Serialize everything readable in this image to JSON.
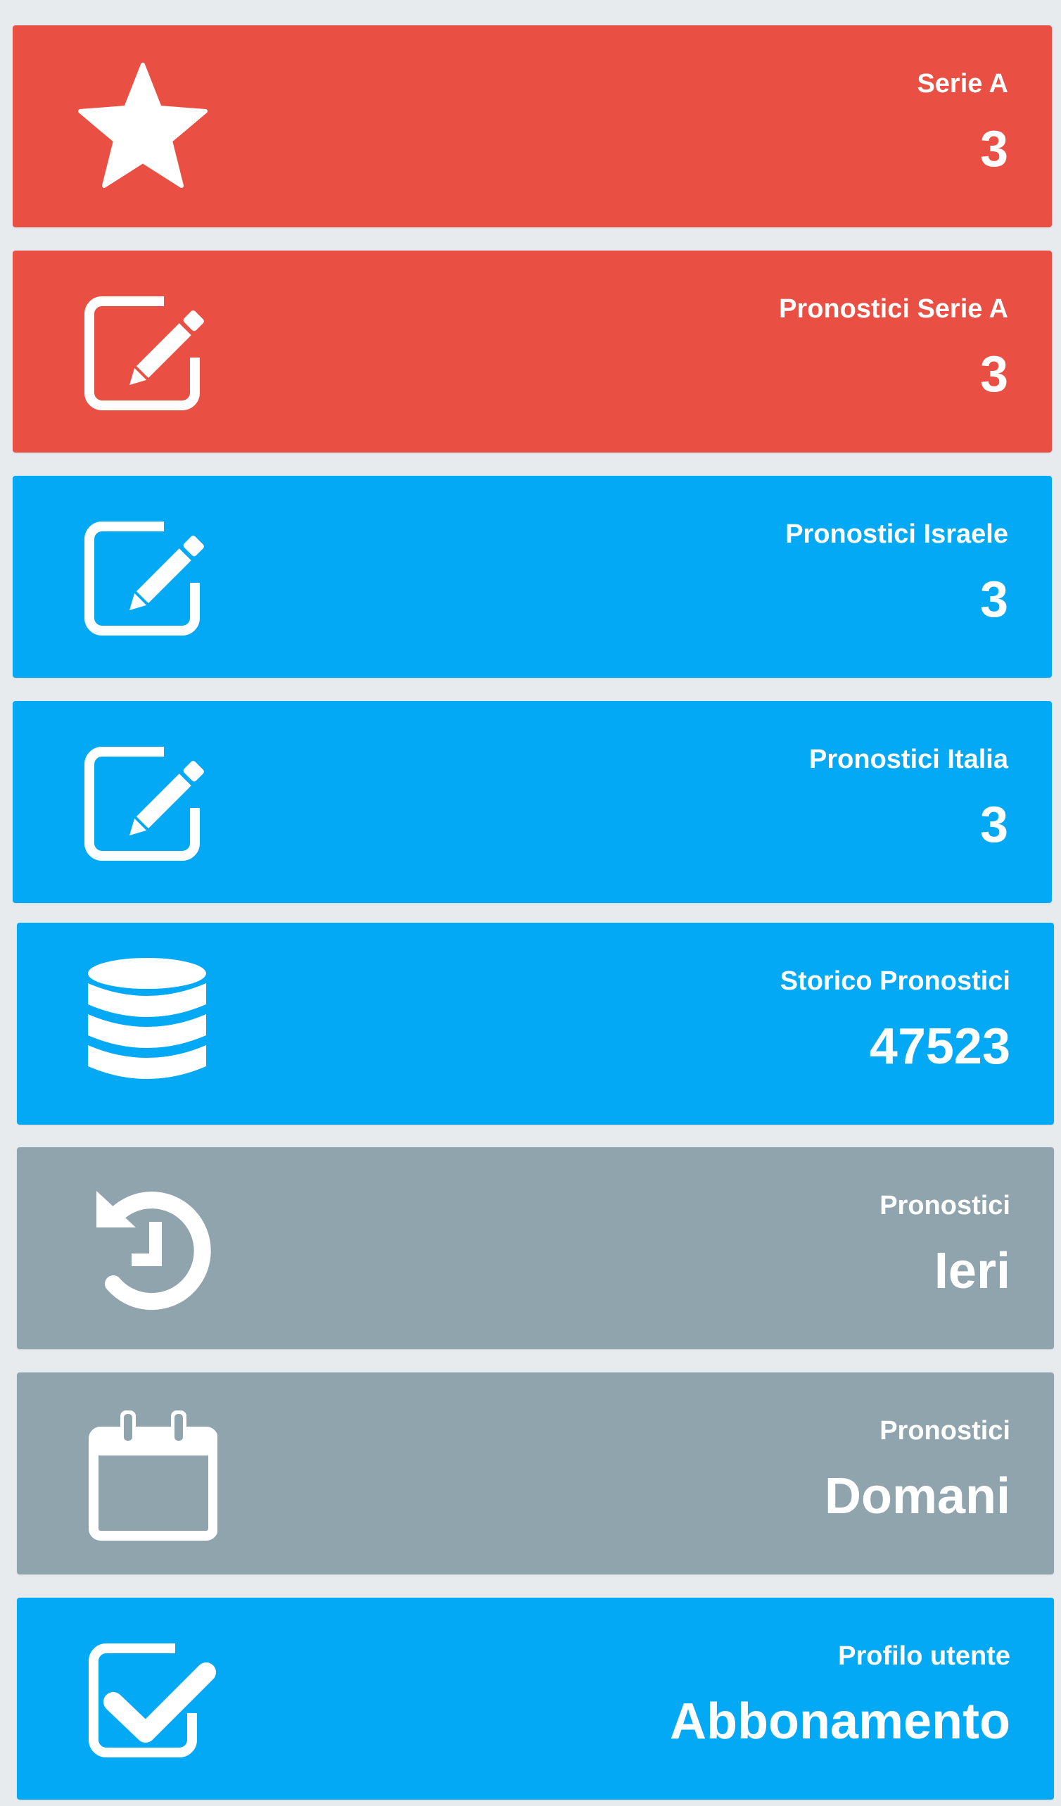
{
  "colors": {
    "background": "#e8ebee",
    "red": "#e94f43",
    "blue": "#03a9f4",
    "gray": "#90a4ae",
    "text": "#ffffff"
  },
  "tiles": [
    {
      "icon": "star-icon",
      "color": "red",
      "title": "Serie A",
      "value": "3"
    },
    {
      "icon": "edit-icon",
      "color": "red",
      "title": "Pronostici Serie A",
      "value": "3"
    },
    {
      "icon": "edit-icon",
      "color": "blue",
      "title": "Pronostici Israele",
      "value": "3"
    },
    {
      "icon": "edit-icon",
      "color": "blue",
      "title": "Pronostici Italia",
      "value": "3"
    },
    {
      "icon": "database-icon",
      "color": "blue",
      "title": "Storico Pronostici",
      "value": "47523"
    },
    {
      "icon": "history-icon",
      "color": "gray",
      "title": "Pronostici",
      "value": "Ieri"
    },
    {
      "icon": "calendar-icon",
      "color": "gray",
      "title": "Pronostici",
      "value": "Domani"
    },
    {
      "icon": "checkbox-icon",
      "color": "blue",
      "title": "Profilo utente",
      "value": "Abbonamento"
    }
  ]
}
